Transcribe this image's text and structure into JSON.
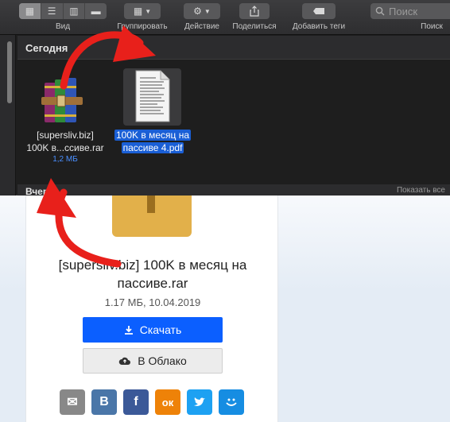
{
  "toolbar": {
    "view_label": "Вид",
    "group_label": "Группировать",
    "action_label": "Действие",
    "share_label": "Поделиться",
    "tags_label": "Добавить теги",
    "search_placeholder": "Поиск",
    "search_label": "Поиск"
  },
  "finder": {
    "section_today": "Сегодня",
    "section_next": "Вчера",
    "section_next_more": "Показать все",
    "files": [
      {
        "line1": "[supersliv.biz]",
        "line2": "100K в...ссиве.rar",
        "size": "1,2 МБ",
        "icon": "winrar-books-icon"
      },
      {
        "line1": "100K в месяц на",
        "line2": "пассиве 4.pdf",
        "icon": "pdf-document-icon",
        "selected": true
      }
    ]
  },
  "webpage": {
    "file_title": "[supersliv.biz] 100K в месяц на пассиве.rar",
    "file_meta": "1.17 МБ, 10.04.2019",
    "download_label": "Скачать",
    "cloud_label": "В Облако",
    "colors": {
      "download": "#0b5fff",
      "arrow": "#e8201b"
    },
    "social": [
      {
        "name": "mail",
        "glyph": "✉",
        "color": "#888888"
      },
      {
        "name": "vk",
        "glyph": "В",
        "color": "#4a76a8"
      },
      {
        "name": "facebook",
        "glyph": "f",
        "color": "#3b5998"
      },
      {
        "name": "odnoklassniki",
        "glyph": "ок",
        "color": "#ee8208"
      },
      {
        "name": "twitter",
        "glyph": "🐦",
        "color": "#1da1f2"
      },
      {
        "name": "moi-mir",
        "glyph": "☺",
        "color": "#168de2"
      }
    ]
  }
}
